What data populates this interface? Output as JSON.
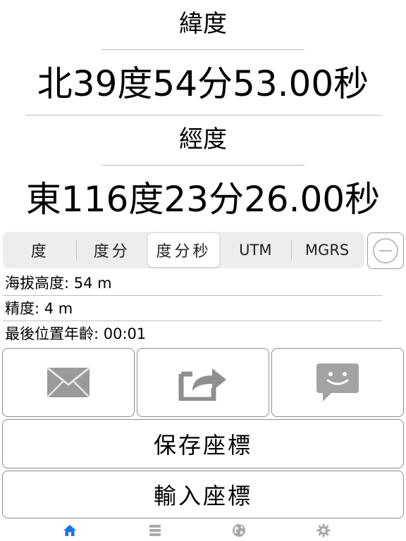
{
  "latitude": {
    "title": "緯度",
    "value": "北39度54分53.00秒"
  },
  "longitude": {
    "title": "經度",
    "value": "東116度23分26.00秒"
  },
  "format_segments": [
    {
      "label": "度",
      "selected": false
    },
    {
      "label": "度分",
      "selected": false
    },
    {
      "label": "度分秒",
      "selected": true
    },
    {
      "label": "UTM",
      "selected": false
    },
    {
      "label": "MGRS",
      "selected": false
    }
  ],
  "minus_button": {
    "icon": "minus-circle-icon"
  },
  "info": {
    "altitude": "海拔高度: 54 m",
    "accuracy": "精度: 4 m",
    "last_location_age": "最後位置年齡: 00:01"
  },
  "action_buttons": {
    "email_icon": "envelope-icon",
    "share_icon": "share-icon",
    "message_icon": "message-bubble-icon"
  },
  "save_button_label": "保存座標",
  "input_button_label": "輸入座標",
  "tabbar": {
    "items": [
      {
        "icon": "home-icon",
        "active": true
      },
      {
        "icon": "list-icon",
        "active": false
      },
      {
        "icon": "globe-icon",
        "active": false
      },
      {
        "icon": "gear-icon",
        "active": false
      }
    ]
  },
  "colors": {
    "accent": "#1a73e8",
    "icon_gray": "#8f8f8f",
    "tab_inactive": "#a8a8a8"
  }
}
